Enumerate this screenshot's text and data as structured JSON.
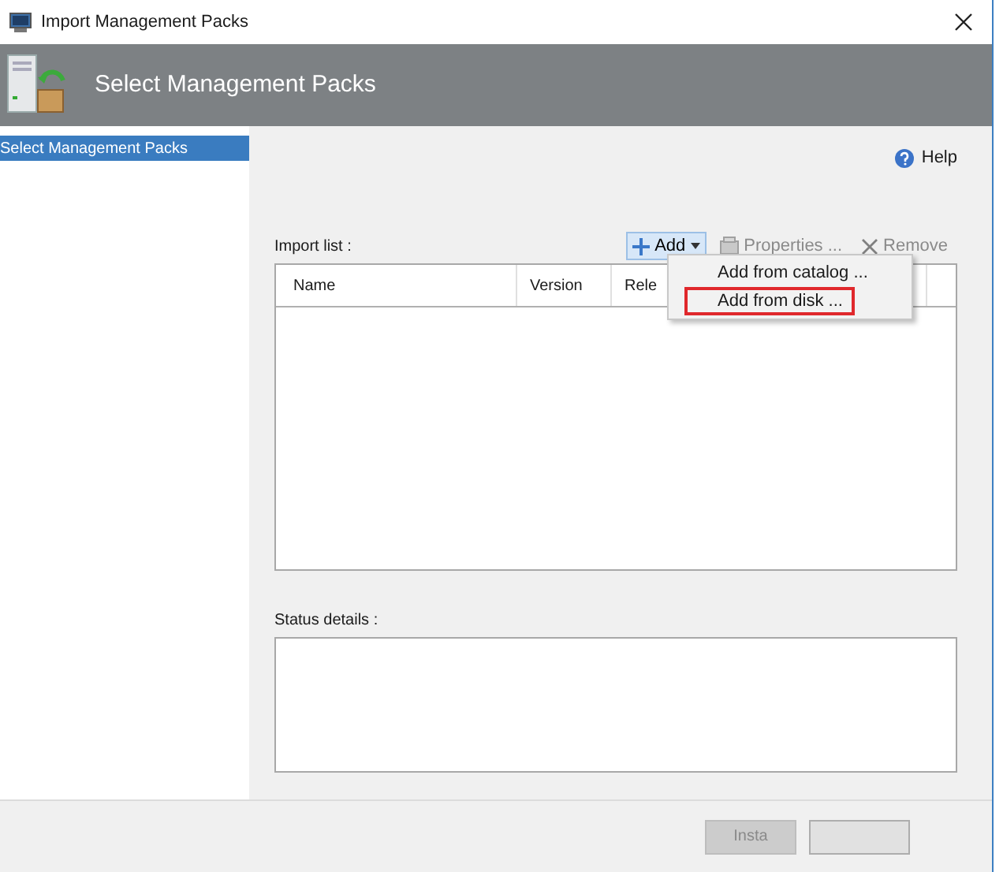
{
  "window": {
    "title": "Import Management Packs"
  },
  "header": {
    "title": "Select Management Packs"
  },
  "sidebar": {
    "items": [
      {
        "label": "Select Management Packs",
        "selected": true
      }
    ]
  },
  "help": {
    "label": "Help"
  },
  "import_list": {
    "label": "Import list :",
    "toolbar": [
      {
        "kind": "dropdown",
        "label": "Add",
        "disabled": false,
        "pressed": true
      },
      {
        "kind": "properties",
        "label": "Properties ...",
        "disabled": true,
        "pressed": false
      },
      {
        "kind": "remove",
        "label": "Remove",
        "disabled": true,
        "pressed": false
      }
    ],
    "columns": [
      "Name",
      "Version",
      "Rele"
    ]
  },
  "menu": {
    "items": [
      {
        "label": "Add from catalog ...",
        "highlighted": false
      },
      {
        "label": "Add from disk ...",
        "highlighted": true
      }
    ]
  },
  "status": {
    "label": "Status details :"
  },
  "buttons": [
    {
      "label": "Insta",
      "disabled": true
    }
  ]
}
